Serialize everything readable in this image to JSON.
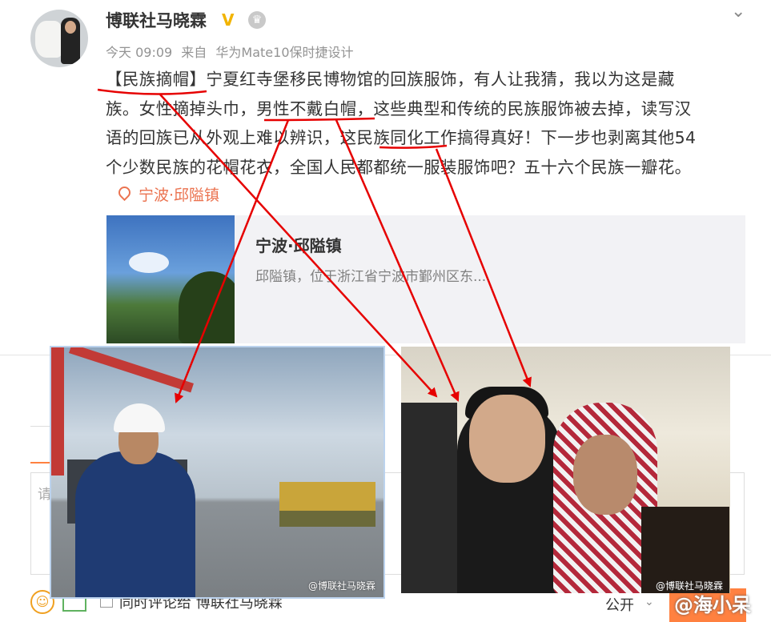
{
  "post": {
    "username": "博联社马晓霖",
    "verified_badge": "V",
    "time": "今天 09:09",
    "source_prefix": "来自",
    "source_device": "华为Mate10保时捷设计",
    "body_lines": [
      "【民族摘帽】宁夏红寺堡移民博物馆的回族服饰，有人让我猜，我以为这是藏",
      "族。女性摘掉头巾，男性不戴白帽，这些典型和传统的民族服饰被去掉，读写汉",
      "语的回族已从外观上难以辨识，这民族同化工作搞得真好！下一步也剥离其他54",
      "个少数民族的花帽花衣，全国人民都都统一服装服饰吧？五十六个民族一瓣花。"
    ],
    "location": "宁波·邱隘镇"
  },
  "location_card": {
    "title": "宁波·邱隘镇",
    "description": "邱隘镇，位于浙江省宁波市鄞州区东..."
  },
  "photos": {
    "left_watermark": "@博联社马晓霖",
    "right_watermark": "@博联社马晓霖"
  },
  "comment_box": {
    "placeholder": "请",
    "also_comment_to": "同时评论给 博联社马晓霖",
    "visibility": "公开"
  },
  "watermark_bottom": "@海小呆",
  "colors": {
    "link": "#eb7350",
    "annotation": "#e60000",
    "send": "#ff8140"
  }
}
